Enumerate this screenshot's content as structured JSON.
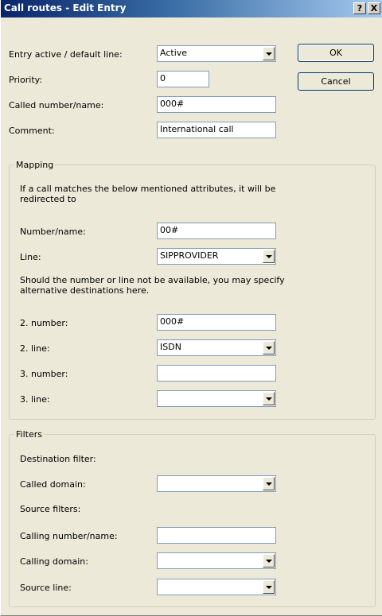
{
  "window": {
    "title": "Call routes - Edit Entry",
    "help_label": "?",
    "close_label": "X"
  },
  "buttons": {
    "ok": "OK",
    "cancel": "Cancel"
  },
  "general": {
    "entry_active_label": "Entry active / default line:",
    "entry_active_value": "Active",
    "priority_label": "Priority:",
    "priority_value": "0",
    "called_label": "Called number/name:",
    "called_value": "000#",
    "comment_label": "Comment:",
    "comment_value": "International call"
  },
  "mapping": {
    "legend": "Mapping",
    "description": "If a call matches the below mentioned attributes, it will be redirected to",
    "number_label": "Number/name:",
    "number_value": "00#",
    "line_label": "Line:",
    "line_value": "SIPPROVIDER",
    "alt_description": "Should the number or line not be available, you may specify alternative destinations here.",
    "number2_label": "2. number:",
    "number2_value": "000#",
    "line2_label": "2. line:",
    "line2_value": "ISDN",
    "number3_label": "3. number:",
    "number3_value": "",
    "line3_label": "3. line:",
    "line3_value": ""
  },
  "filters": {
    "legend": "Filters",
    "destination_filter_label": "Destination filter:",
    "called_domain_label": "Called domain:",
    "called_domain_value": "",
    "source_filters_label": "Source filters:",
    "calling_number_label": "Calling number/name:",
    "calling_number_value": "",
    "calling_domain_label": "Calling domain:",
    "calling_domain_value": "",
    "source_line_label": "Source line:",
    "source_line_value": ""
  }
}
